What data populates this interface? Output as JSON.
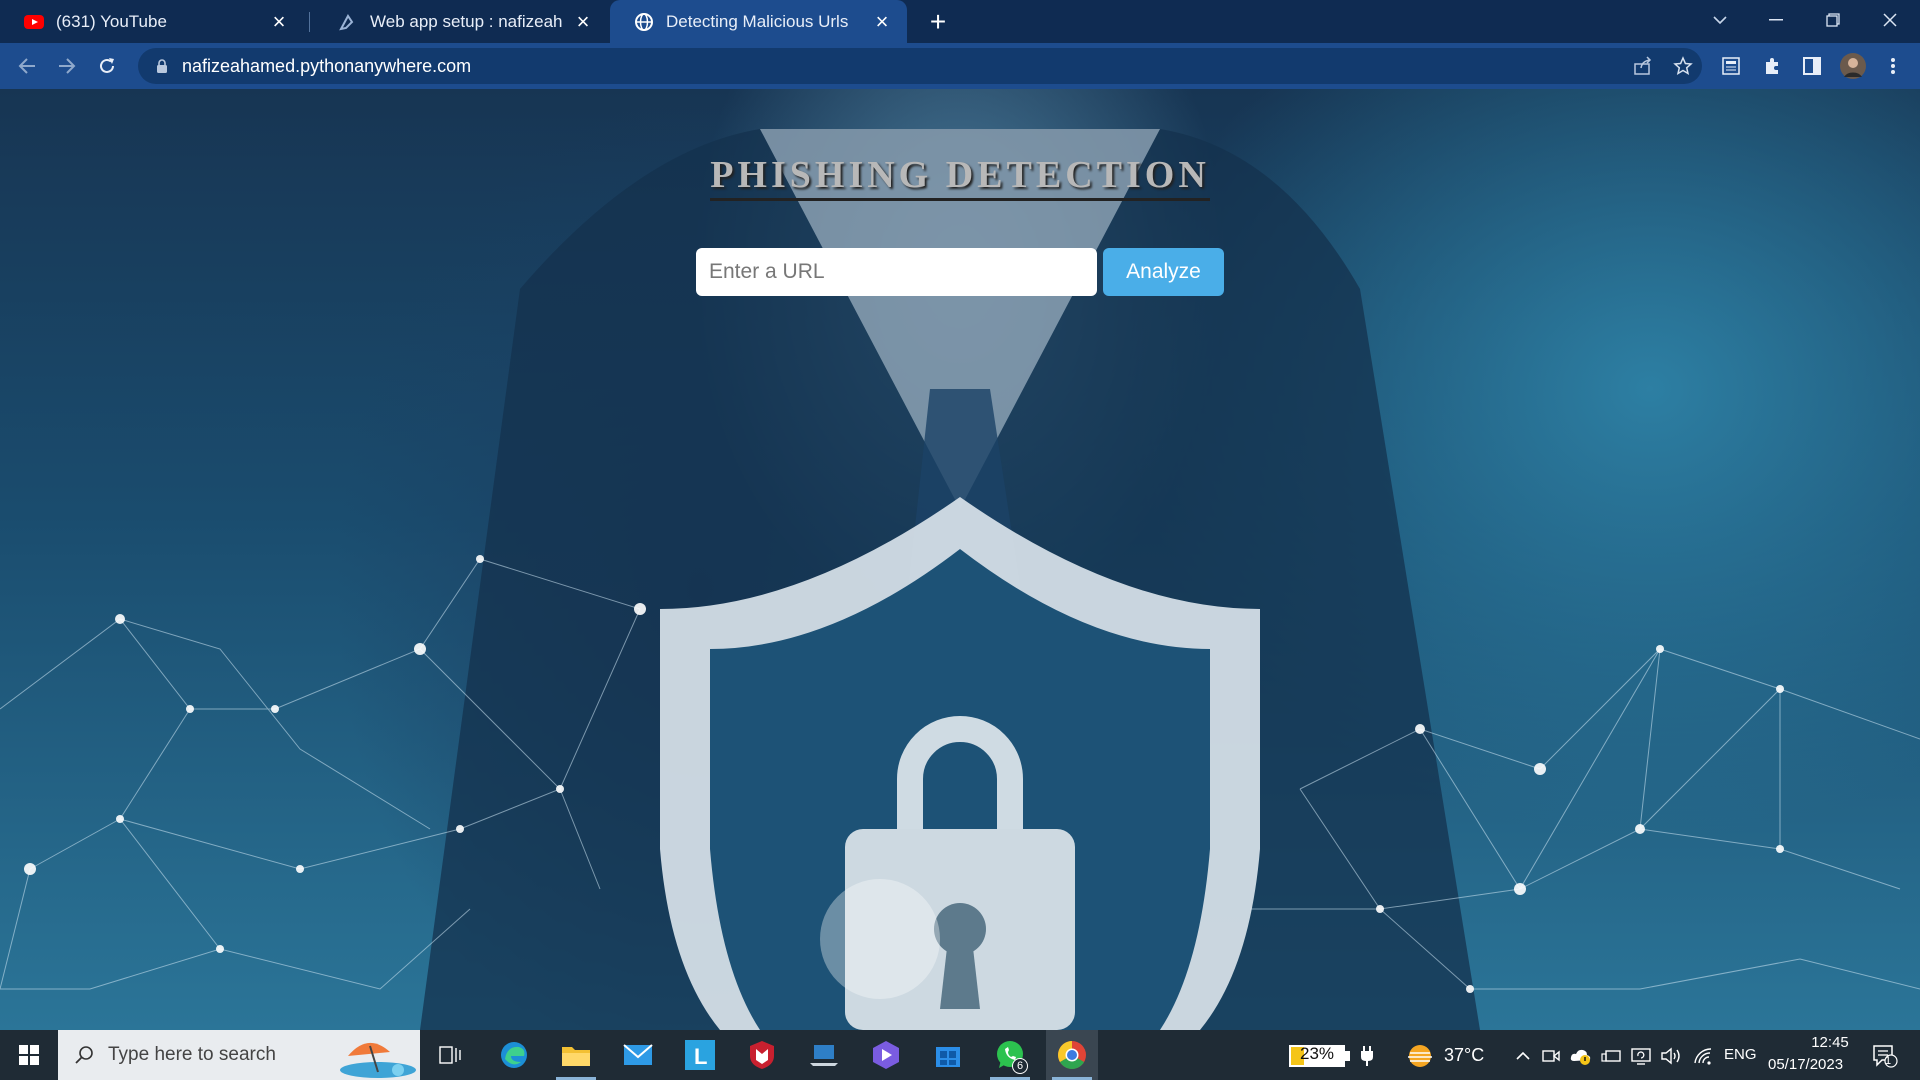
{
  "browser": {
    "tabs": [
      {
        "title": "(631) YouTube",
        "icon": "youtube-icon",
        "active": false
      },
      {
        "title": "Web app setup : nafizeahamed : PythonAnywhere",
        "icon": "pythonanywhere-icon",
        "active": false
      },
      {
        "title": "Detecting Malicious Urls",
        "icon": "globe-icon",
        "active": true
      }
    ],
    "address": "nafizeahamed.pythonanywhere.com"
  },
  "page": {
    "title": "PHISHING DETECTION",
    "url_placeholder": "Enter a URL",
    "url_value": "",
    "analyze_label": "Analyze"
  },
  "taskbar": {
    "search_placeholder": "Type here to search",
    "whatsapp_badge": "6",
    "battery": "23%",
    "weather": "37°C",
    "language": "ENG",
    "time": "12:45",
    "date": "05/17/2023",
    "notification_count": "1"
  },
  "colors": {
    "tabstrip": "#0f2b52",
    "toolbar": "#1d4c8e",
    "analyze_button": "#4aaee8",
    "taskbar": "#1f2b35"
  }
}
